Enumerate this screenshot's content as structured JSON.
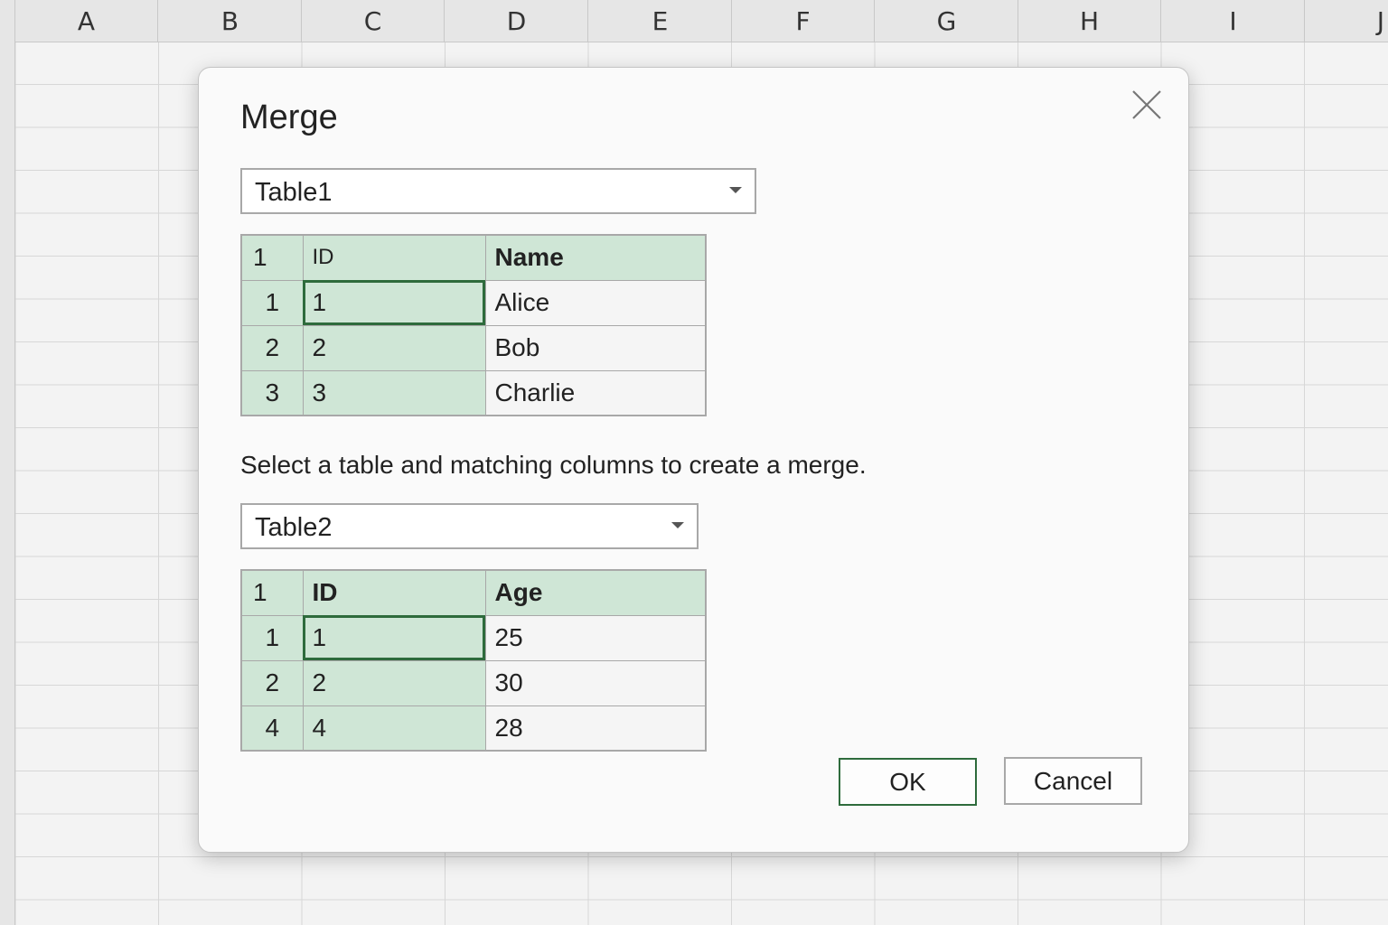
{
  "sheet": {
    "columns": [
      "A",
      "B",
      "C",
      "D",
      "E",
      "F",
      "G",
      "H",
      "I",
      "J"
    ]
  },
  "dialog": {
    "title": "Merge",
    "instruction": "Select a table and matching columns to create a merge.",
    "ok_label": "OK",
    "cancel_label": "Cancel",
    "primary": {
      "selected_table": "Table1",
      "header": {
        "index": "1",
        "col1": "ID",
        "col2": "Name"
      },
      "rows": [
        {
          "index": "1",
          "id": "1",
          "value": "Alice"
        },
        {
          "index": "2",
          "id": "2",
          "value": "Bob"
        },
        {
          "index": "3",
          "id": "3",
          "value": "Charlie"
        }
      ]
    },
    "secondary": {
      "selected_table": "Table2",
      "header": {
        "index": "1",
        "col1": "ID",
        "col2": "Age"
      },
      "rows": [
        {
          "index": "1",
          "id": "1",
          "value": "25"
        },
        {
          "index": "2",
          "id": "2",
          "value": "30"
        },
        {
          "index": "4",
          "id": "4",
          "value": "28"
        }
      ]
    }
  },
  "colors": {
    "accent": "#2e6b3c",
    "key_column_fill": "#cfe6d6"
  },
  "icons": {
    "close": "close-icon",
    "dropdown": "chevron-down-icon"
  }
}
